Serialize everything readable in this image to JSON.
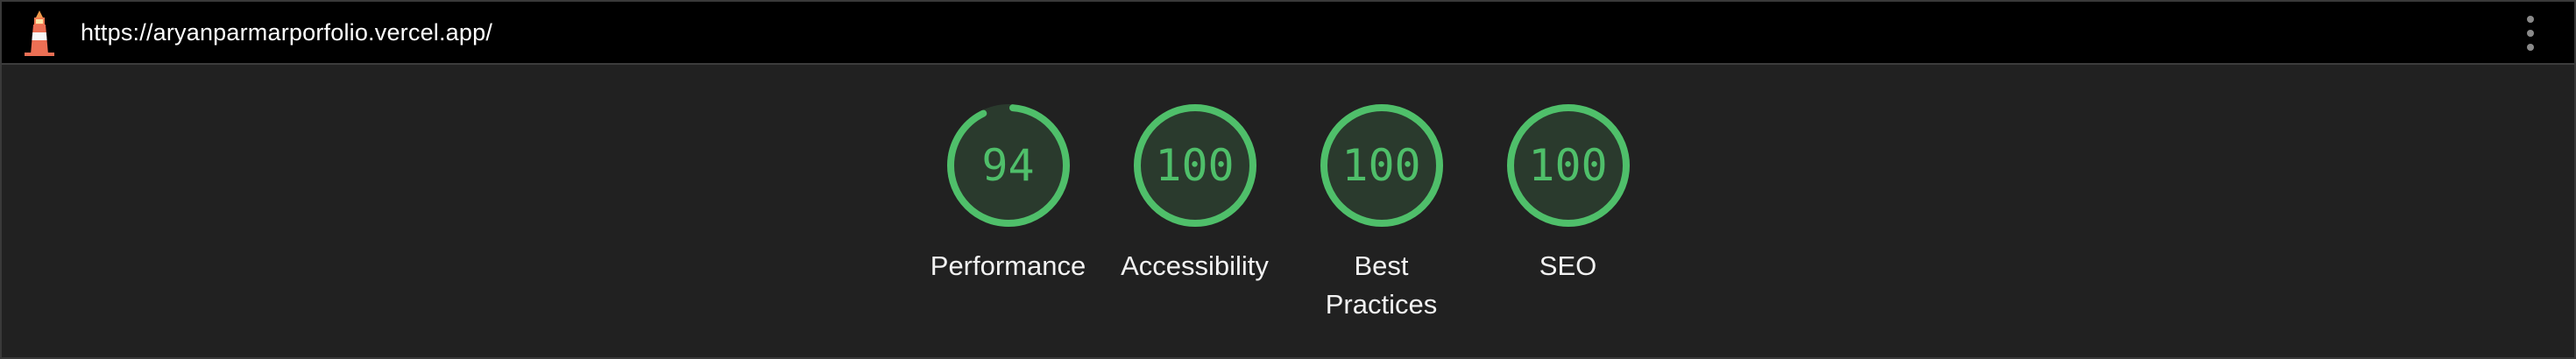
{
  "header": {
    "url": "https://aryanparmarporfolio.vercel.app/",
    "logo_icon": "lighthouse-icon",
    "menu_icon": "more-vertical-icon"
  },
  "colors": {
    "pass": "#4fbf6a",
    "pass_fill": "#2a3a2d",
    "background": "#212121",
    "topbar": "#000000"
  },
  "scores": [
    {
      "label": "Performance",
      "score": 94
    },
    {
      "label": "Accessibility",
      "score": 100
    },
    {
      "label_lines": [
        "Best",
        "Practices"
      ],
      "label": "Best Practices",
      "score": 100
    },
    {
      "label": "SEO",
      "score": 100
    }
  ]
}
